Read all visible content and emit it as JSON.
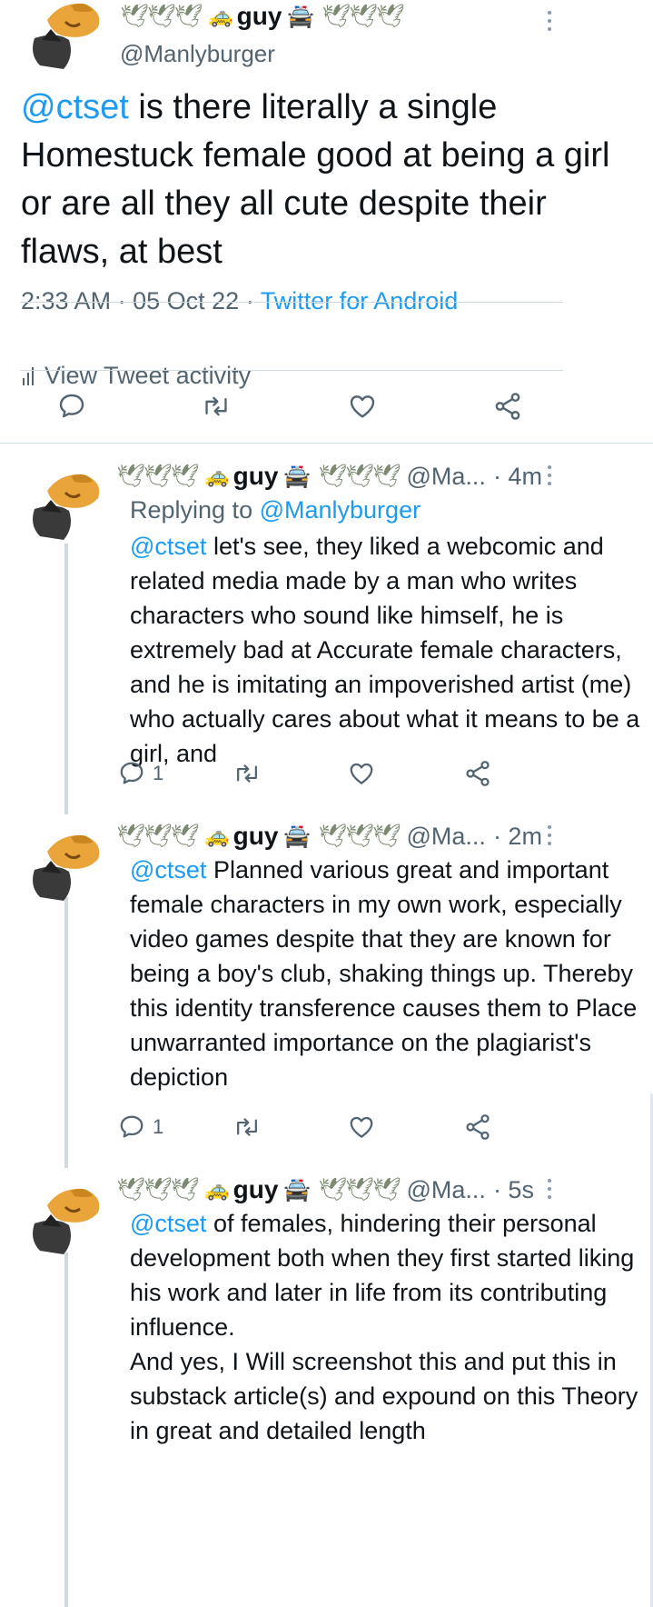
{
  "main_tweet": {
    "deco_left": "🕊🕊🕊",
    "deco_right": "🕊🕊🕊",
    "car_emoji": "🚕",
    "van_emoji": "🚔",
    "display_name": "guy",
    "handle": "@Manlyburger",
    "mention": "@ctset",
    "text": " is there literally a single Homestuck female good at being a girl or are all they all cute despite their flaws, at best",
    "time": "2:33 AM",
    "sep": "·",
    "date": "05 Oct 22",
    "source": "Twitter for Android",
    "activity_label": "View Tweet activity"
  },
  "replies": [
    {
      "deco_left": "🕊🕊🕊",
      "deco_right": "🕊🕊🕊",
      "car_emoji": "🚕",
      "van_emoji": "🚔",
      "display_name": "guy",
      "handle": "@Ma...",
      "time": "· 4m",
      "replying_prefix": "Replying to ",
      "replying_handle": "@Manlyburger",
      "mention": "@ctset",
      "text": " let's see, they liked a webcomic and related media made by a man who writes characters who sound like himself, he is extremely bad at Accurate female characters, and he is imitating an impoverished artist (me) who actually cares about what it means to be a girl, and",
      "reply_count": "1"
    },
    {
      "deco_left": "🕊🕊🕊",
      "deco_right": "🕊🕊🕊",
      "car_emoji": "🚕",
      "van_emoji": "🚔",
      "display_name": "guy",
      "handle": "@Ma...",
      "time": "· 2m",
      "mention": "@ctset",
      "text": " Planned various great and important female characters in my own work, especially video games despite that they are known for being a boy's club, shaking things up. Thereby this identity transference causes them to Place unwarranted importance on the plagiarist's depiction",
      "reply_count": "1"
    },
    {
      "deco_left": "🕊🕊🕊",
      "deco_right": "🕊🕊🕊",
      "car_emoji": "🚕",
      "van_emoji": "🚔",
      "display_name": "guy",
      "handle": "@Ma...",
      "time": "· 5s",
      "mention": "@ctset",
      "text": " of females, hindering their personal development both when they first started liking his work and later in life from its contributing influence.",
      "text2": "And yes, I Will screenshot this and put this in substack article(s) and expound on this Theory in great and detailed length"
    }
  ],
  "colors": {
    "accent": "#1d9bf0",
    "muted": "#536471",
    "divider": "#cfd9de"
  }
}
